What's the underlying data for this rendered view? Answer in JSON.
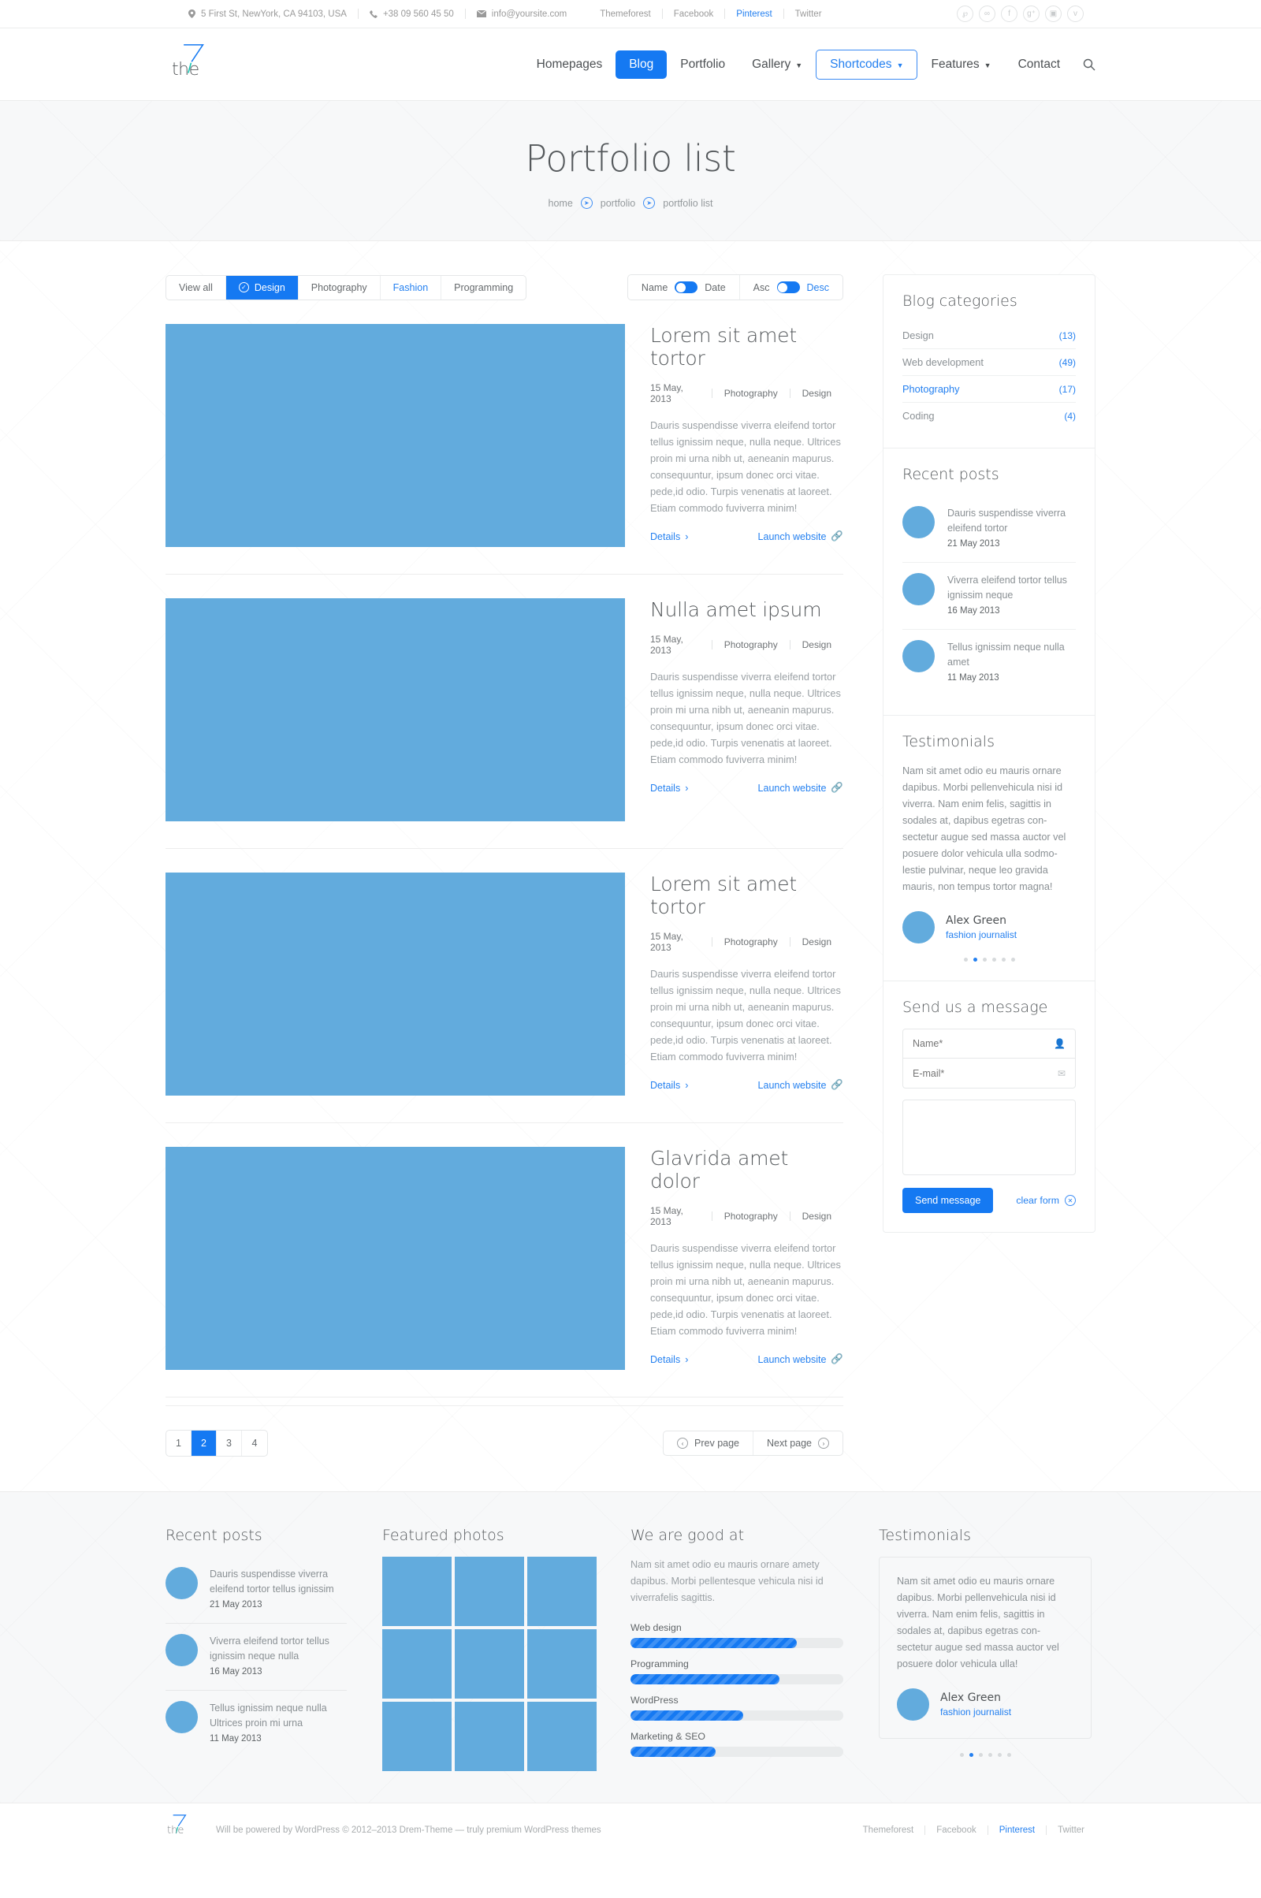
{
  "topbar": {
    "address": "5 First St, NewYork, CA 94103, USA",
    "phone": "+38 09 560 45 50",
    "email": "info@yoursite.com",
    "links": [
      {
        "label": "Themeforest",
        "active": false
      },
      {
        "label": "Facebook",
        "active": false
      },
      {
        "label": "Pinterest",
        "active": true
      },
      {
        "label": "Twitter",
        "active": false
      }
    ],
    "social": [
      {
        "name": "pinterest-icon",
        "glyph": "℘"
      },
      {
        "name": "flickr-icon",
        "glyph": "∞"
      },
      {
        "name": "facebook-icon",
        "glyph": "f"
      },
      {
        "name": "googleplus-icon",
        "glyph": "g⁺"
      },
      {
        "name": "instagram-icon",
        "glyph": "▣"
      },
      {
        "name": "twitter-icon",
        "glyph": "ᴠ"
      }
    ]
  },
  "header": {
    "logo_text": "the",
    "nav": [
      {
        "label": "Homepages",
        "state": "normal",
        "caret": false
      },
      {
        "label": "Blog",
        "state": "active",
        "caret": false
      },
      {
        "label": "Portfolio",
        "state": "normal",
        "caret": false
      },
      {
        "label": "Gallery",
        "state": "normal",
        "caret": true
      },
      {
        "label": "Shortcodes",
        "state": "outlined",
        "caret": true
      },
      {
        "label": "Features",
        "state": "normal",
        "caret": true
      },
      {
        "label": "Contact",
        "state": "normal",
        "caret": false
      }
    ],
    "search_icon": "search-icon"
  },
  "page": {
    "title": "Portfolio list",
    "breadcrumb": [
      "home",
      "portfolio",
      "portfolio list"
    ]
  },
  "filters": {
    "buttons": [
      {
        "label": "View all",
        "state": "normal"
      },
      {
        "label": "Design",
        "state": "active"
      },
      {
        "label": "Photography",
        "state": "normal"
      },
      {
        "label": "Fashion",
        "state": "highlight"
      },
      {
        "label": "Programming",
        "state": "normal"
      }
    ],
    "sort": [
      {
        "left": "Name",
        "right": "Date",
        "on": "right"
      },
      {
        "left": "Asc",
        "right": "Desc",
        "on": "right"
      }
    ]
  },
  "portfolio_items": [
    {
      "title": "Lorem sit amet tortor",
      "date": "15 May, 2013",
      "cat1": "Photography",
      "cat2": "Design",
      "desc": "Dauris suspendisse viverra eleifend tortor tellus ignissim neque, nulla neque. Ultrices proin mi urna nibh ut, aeneanin mapurus. consequuntur, ipsum donec orci vitae. pede,id odio. Turpis venenatis at laoreet. Etiam commodo fuviverra minim!",
      "details_label": "Details",
      "launch_label": "Launch website"
    },
    {
      "title": "Nulla amet ipsum",
      "date": "15 May, 2013",
      "cat1": "Photography",
      "cat2": "Design",
      "desc": "Dauris suspendisse viverra eleifend tortor tellus ignissim neque, nulla neque. Ultrices proin mi urna nibh ut, aeneanin mapurus. consequuntur, ipsum donec orci vitae. pede,id odio. Turpis venenatis at laoreet. Etiam commodo fuviverra minim!",
      "details_label": "Details",
      "launch_label": "Launch website"
    },
    {
      "title": "Lorem sit amet tortor",
      "date": "15 May, 2013",
      "cat1": "Photography",
      "cat2": "Design",
      "desc": "Dauris suspendisse viverra eleifend tortor tellus ignissim neque, nulla neque. Ultrices proin mi urna nibh ut, aeneanin mapurus. consequuntur, ipsum donec orci vitae. pede,id odio. Turpis venenatis at laoreet. Etiam commodo fuviverra minim!",
      "details_label": "Details",
      "launch_label": "Launch website"
    },
    {
      "title": "Glavrida amet dolor",
      "date": "15 May, 2013",
      "cat1": "Photography",
      "cat2": "Design",
      "desc": "Dauris suspendisse viverra eleifend tortor tellus ignissim neque, nulla neque. Ultrices proin mi urna nibh ut, aeneanin mapurus. consequuntur, ipsum donec orci vitae. pede,id odio. Turpis venenatis at laoreet. Etiam commodo fuviverra minim!",
      "details_label": "Details",
      "launch_label": "Launch website"
    }
  ],
  "pagination": {
    "pages": [
      "1",
      "2",
      "3",
      "4"
    ],
    "current": "2",
    "prev_label": "Prev page",
    "next_label": "Next page"
  },
  "sidebar": {
    "categories": {
      "title": "Blog categories",
      "items": [
        {
          "name": "Design",
          "count": "(13)",
          "active": false
        },
        {
          "name": "Web development",
          "count": "(49)",
          "active": false
        },
        {
          "name": "Photography",
          "count": "(17)",
          "active": true
        },
        {
          "name": "Coding",
          "count": "(4)",
          "active": false
        }
      ]
    },
    "recent_posts": {
      "title": "Recent posts",
      "items": [
        {
          "text": "Dauris suspendisse viverra eleifend tortor",
          "date": "21 May 2013"
        },
        {
          "text": "Viverra eleifend tortor tellus ignissim neque",
          "date": "16 May 2013"
        },
        {
          "text": "Tellus ignissim neque nulla amet",
          "date": "11 May 2013"
        }
      ]
    },
    "testimonials": {
      "title": "Testimonials",
      "text": "Nam sit amet odio eu mauris ornare dapibus. Morbi pellenvehicula nisi id viverra. Nam enim felis, sagittis in sodales at, dapibus egetras con-sectetur augue sed massa auctor vel posuere dolor vehicula ulla sodmo-lestie pulvinar, neque leo gravida mauris, non tempus tortor magna!",
      "author": "Alex Green",
      "role": "fashion journalist",
      "dots": 6,
      "active_dot": 1
    },
    "contact_form": {
      "title": "Send us a message",
      "name_placeholder": "Name*",
      "name_value": "",
      "email_placeholder": "E-mail*",
      "email_value": "",
      "message_value": "",
      "send_label": "Send message",
      "clear_label": "clear form"
    }
  },
  "footer_widgets": {
    "recent_posts": {
      "title": "Recent posts",
      "items": [
        {
          "text": "Dauris suspendisse viverra eleifend tortor tellus ignissim",
          "date": "21 May 2013"
        },
        {
          "text": "Viverra eleifend tortor tellus ignissim neque nulla",
          "date": "16 May 2013"
        },
        {
          "text": "Tellus ignissim neque nulla Ultrices proin mi urna",
          "date": "11 May 2013"
        }
      ]
    },
    "featured_photos": {
      "title": "Featured photos",
      "count": 9
    },
    "skills": {
      "title": "We are good at",
      "desc": "Nam sit amet odio eu mauris ornare amety dapibus. Morbi pellentesque vehicula nisi id viverrafelis sagittis.",
      "items": [
        {
          "label": "Web design",
          "value": 78
        },
        {
          "label": "Programming",
          "value": 70
        },
        {
          "label": "WordPress",
          "value": 53
        },
        {
          "label": "Marketing & SEO",
          "value": 40
        }
      ]
    },
    "testimonials": {
      "title": "Testimonials",
      "text": "Nam sit amet odio eu mauris ornare dapibus. Morbi pellenvehicula nisi id viverra. Nam enim felis, sagittis in sodales at, dapibus egetras con-sectetur augue sed massa auctor vel posuere dolor vehicula ulla!",
      "author": "Alex Green",
      "role": "fashion journalist",
      "dots": 6,
      "active_dot": 1
    }
  },
  "footer_bottom": {
    "logo_text": "the",
    "copyright": "Will be powered by WordPress © 2012–2013 Drem-Theme — truly premium WordPress themes",
    "links": [
      {
        "label": "Themeforest",
        "active": false
      },
      {
        "label": "Facebook",
        "active": false
      },
      {
        "label": "Pinterest",
        "active": true
      },
      {
        "label": "Twitter",
        "active": false
      }
    ]
  },
  "colors": {
    "accent": "#1579f2",
    "link": "#2480f0",
    "placeholder_image": "#62abdd",
    "page_bg_light": "#f7f8f9"
  }
}
